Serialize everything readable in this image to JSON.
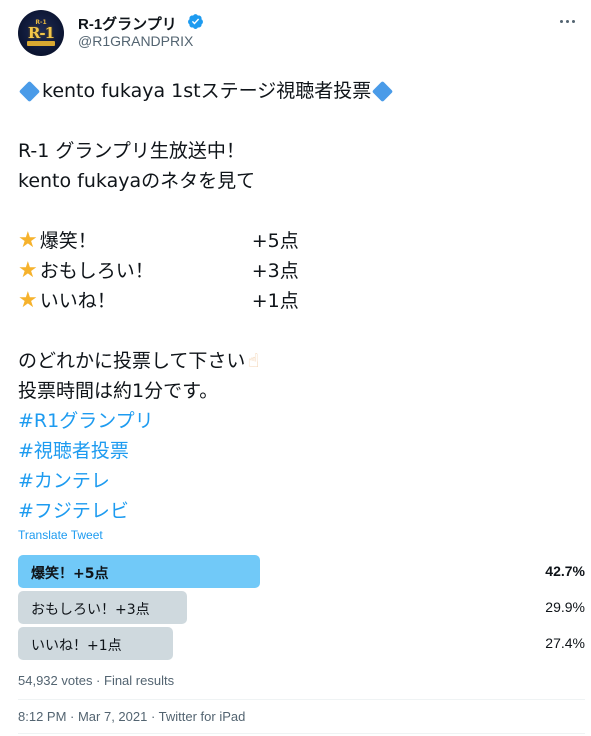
{
  "header": {
    "display_name": "R-1グランプリ",
    "handle": "@R1GRANDPRIX",
    "avatar_logo_top": "R-1",
    "avatar_logo_main": "R-1"
  },
  "tweet": {
    "title": "kento fukaya 1stステージ視聴者投票",
    "line1": "R-1 グランプリ生放送中！",
    "line2": "kento fukayaのネタを見て",
    "scores": [
      {
        "label": "爆笑！",
        "points": "+5点"
      },
      {
        "label": "おもしろい！",
        "points": "+3点"
      },
      {
        "label": "いいね！",
        "points": "+1点"
      }
    ],
    "line3": "のどれかに投票して下さい",
    "line4": "投票時間は約1分です。",
    "hashtags": [
      "#R1グランプリ",
      "#視聴者投票",
      "#カンテレ",
      "#フジテレビ"
    ]
  },
  "translate_label": "Translate Tweet",
  "poll": {
    "options": [
      {
        "label": "爆笑！+5点",
        "percent": "42.7%",
        "fraction": 0.427,
        "winner": true
      },
      {
        "label": "おもしろい！+3点",
        "percent": "29.9%",
        "fraction": 0.299,
        "winner": false
      },
      {
        "label": "いいね！+1点",
        "percent": "27.4%",
        "fraction": 0.274,
        "winner": false
      }
    ],
    "meta": "54,932 votes · Final results"
  },
  "timestamp": "8:12 PM · Mar 7, 2021 · Twitter for iPad",
  "colors": {
    "accent": "#1d9bf0",
    "winner_bar": "#71c9f8",
    "other_bar": "#cfd9de"
  }
}
